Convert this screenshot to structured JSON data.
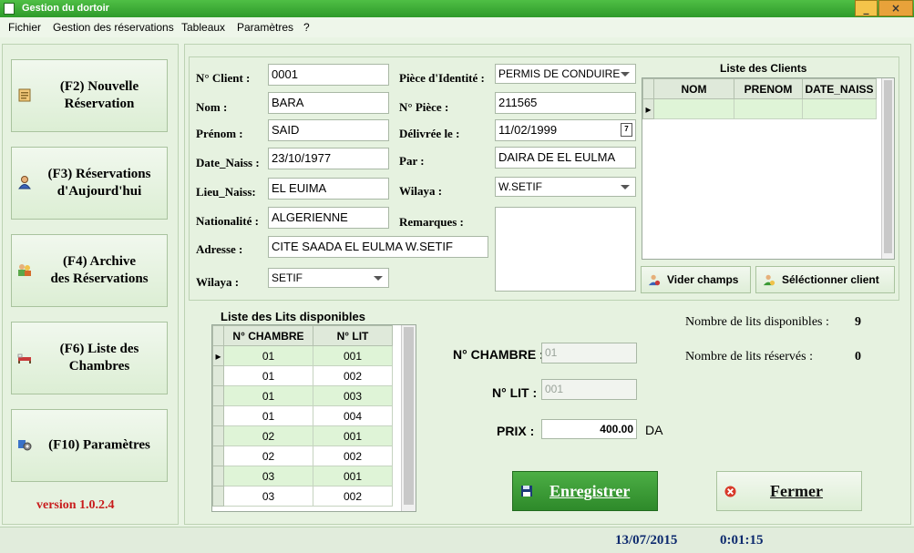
{
  "window": {
    "title": "Gestion du dortoir",
    "min_icon": "_",
    "close_icon": "×"
  },
  "menu": [
    "Fichier",
    "Gestion des réservations",
    "Tableaux",
    "Paramètres",
    "?"
  ],
  "nav": [
    {
      "line1": "(F2) Nouvelle",
      "line2": "Réservation",
      "icon": "clipboard-icon"
    },
    {
      "line1": "(F3) Réservations",
      "line2": "d'Aujourd'hui",
      "icon": "person-icon"
    },
    {
      "line1": "(F4) Archive",
      "line2": "des Réservations",
      "icon": "archive-icon"
    },
    {
      "line1": "(F6) Liste des",
      "line2": "Chambres",
      "icon": "bed-icon"
    },
    {
      "line1": "(F10) Paramètres",
      "line2": "",
      "icon": "settings-icon"
    }
  ],
  "version": "version 1.0.2.4",
  "client_form": {
    "labels": {
      "num_client": "N° Client :",
      "nom": "Nom :",
      "prenom": "Prénom :",
      "date_naiss": "Date_Naiss :",
      "lieu_naiss": "Lieu_Naiss:",
      "nationalite": "Nationalité :",
      "adresse": "Adresse :",
      "wilaya": "Wilaya :",
      "piece_identite": "Pièce d'Identité :",
      "num_piece": "N° Pièce :",
      "delivree_le": "Délivrée le :",
      "par": "Par :",
      "wilaya2": "Wilaya :",
      "remarques": "Remarques :"
    },
    "values": {
      "num_client": "0001",
      "nom": "BARA",
      "prenom": "SAID",
      "date_naiss": "23/10/1977",
      "lieu_naiss": "EL EUIMA",
      "nationalite": "ALGERIENNE",
      "adresse": "CITE SAADA EL EULMA W.SETIF",
      "wilaya": "SETIF",
      "piece_identite": "PERMIS DE CONDUIRE",
      "num_piece": "211565",
      "delivree_le": "11/02/1999",
      "par": "DAIRA DE EL EULMA",
      "wilaya2": "W.SETIF",
      "remarques": ""
    },
    "calendar_day": "7"
  },
  "clients_list": {
    "title": "Liste des Clients",
    "columns": [
      "NOM",
      "PRENOM",
      "DATE_NAISS"
    ],
    "current_marker": "▸"
  },
  "buttons": {
    "vider": "Vider champs",
    "selectionner": "Séléctionner client",
    "enregistrer": "Enregistrer",
    "fermer": "Fermer"
  },
  "beds": {
    "title": "Liste des Lits disponibles",
    "columns": [
      "N° CHAMBRE",
      "N° LIT"
    ],
    "current_marker": "▸",
    "rows": [
      {
        "chambre": "01",
        "lit": "001"
      },
      {
        "chambre": "01",
        "lit": "002"
      },
      {
        "chambre": "01",
        "lit": "003"
      },
      {
        "chambre": "01",
        "lit": "004"
      },
      {
        "chambre": "02",
        "lit": "001"
      },
      {
        "chambre": "02",
        "lit": "002"
      },
      {
        "chambre": "03",
        "lit": "001"
      },
      {
        "chambre": "03",
        "lit": "002"
      }
    ]
  },
  "reservation": {
    "chambre_label": "N° CHAMBRE :",
    "chambre_value": "01",
    "lit_label": "N° LIT :",
    "lit_value": "001",
    "prix_label": "PRIX :",
    "prix_value": "400.00",
    "currency": "DA"
  },
  "stats": {
    "disponibles_label": "Nombre de lits disponibles :",
    "disponibles": "9",
    "reserves_label": "Nombre de lits réservés :",
    "reserves": "0"
  },
  "status": {
    "date": "13/07/2015",
    "time": "0:01:15"
  },
  "colors": {
    "title_green": "#2e9a2a",
    "accent_green": "#3a9a35",
    "version_red": "#c81c1c",
    "status_blue": "#0d2a6e",
    "row_alt": "#dff4d7"
  }
}
